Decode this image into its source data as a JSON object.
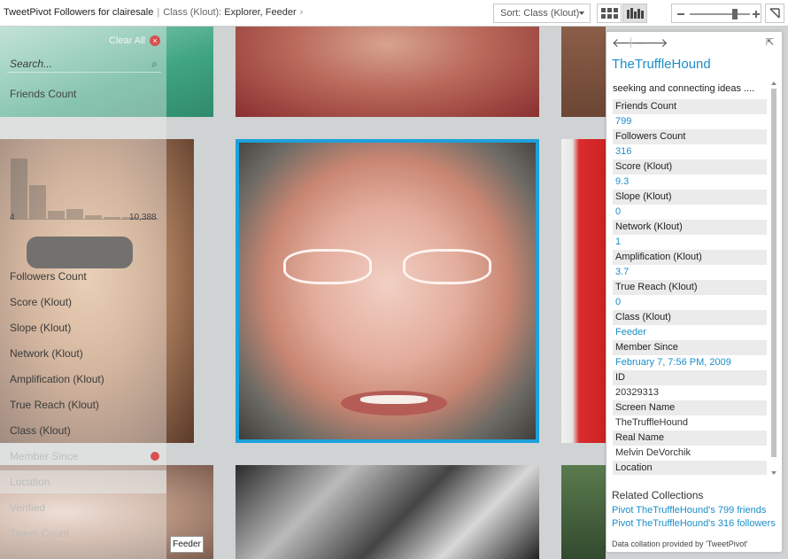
{
  "breadcrumb": {
    "title": "TweetPivot Followers for clairesale",
    "separator": "|",
    "facet": "Class (Klout):",
    "values": "Explorer, Feeder",
    "chevron": "›"
  },
  "toolbar": {
    "sort_label": "Sort: Class (Klout)",
    "grid_view_icon": "grid-icon",
    "graph_view_icon": "histogram-icon",
    "active_view": "graph",
    "zoom_level": 0.75
  },
  "filter": {
    "clear_all": "Clear All",
    "search_placeholder": "Search...",
    "friends_count": {
      "label": "Friends Count",
      "min": "4",
      "max": "10,388",
      "histogram": [
        0.9,
        0.5,
        0.12,
        0.15,
        0.05,
        0.03,
        0.02,
        0.01
      ]
    },
    "categories": [
      "Followers Count",
      "Score (Klout)",
      "Slope (Klout)",
      "Network (Klout)",
      "Amplification (Klout)",
      "True Reach (Klout)",
      "Class (Klout)"
    ],
    "dim_categories": [
      "Member Since",
      "Location",
      "Verified",
      "Tweet Count"
    ]
  },
  "tooltip": "Feeder",
  "info": {
    "name": "TheTruffleHound",
    "description": "seeking and connecting ideas ....",
    "fields": [
      {
        "label": "Friends Count",
        "value": "799",
        "link": true
      },
      {
        "label": "Followers Count",
        "value": "316",
        "link": true
      },
      {
        "label": "Score (Klout)",
        "value": "9.3",
        "link": true
      },
      {
        "label": "Slope (Klout)",
        "value": "0",
        "link": true
      },
      {
        "label": "Network (Klout)",
        "value": "1",
        "link": true
      },
      {
        "label": "Amplification (Klout)",
        "value": "3.7",
        "link": true
      },
      {
        "label": "True Reach (Klout)",
        "value": "0",
        "link": true
      },
      {
        "label": "Class (Klout)",
        "value": "Feeder",
        "link": true
      },
      {
        "label": "Member Since",
        "value": "February 7, 7:56 PM, 2009",
        "link": true
      },
      {
        "label": "ID",
        "value": "20329313",
        "link": false
      },
      {
        "label": "Screen Name",
        "value": "TheTruffleHound",
        "link": false
      },
      {
        "label": "Real Name",
        "value": "Melvin DeVorchik",
        "link": false
      },
      {
        "label": "Location",
        "value": "",
        "link": false
      }
    ],
    "related_heading": "Related Collections",
    "related_links": [
      "Pivot TheTruffleHound's 799 friends",
      "Pivot TheTruffleHound's 316 followers"
    ],
    "credit": "Data collation provided by 'TweetPivot'"
  },
  "colors": {
    "accent": "#1b8ec9",
    "selection_border": "#1ea0dc",
    "clear_icon": "#d85050"
  }
}
